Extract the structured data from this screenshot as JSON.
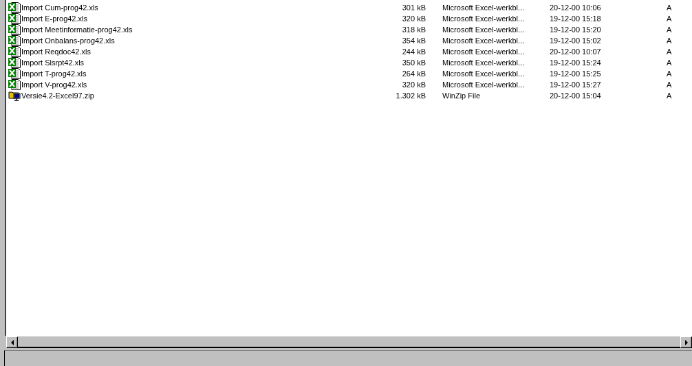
{
  "files": [
    {
      "name": "Import Cum-prog42.xls",
      "kind": "excel",
      "size": "301 kB",
      "type": "Microsoft Excel-werkbl...",
      "modified": "20-12-00 10:06",
      "attributes": "A"
    },
    {
      "name": "Import E-prog42.xls",
      "kind": "excel",
      "size": "320 kB",
      "type": "Microsoft Excel-werkbl...",
      "modified": "19-12-00 15:18",
      "attributes": "A"
    },
    {
      "name": "Import Meetinformatie-prog42.xls",
      "kind": "excel",
      "size": "318 kB",
      "type": "Microsoft Excel-werkbl...",
      "modified": "19-12-00 15:20",
      "attributes": "A"
    },
    {
      "name": "Import Onbalans-prog42.xls",
      "kind": "excel",
      "size": "354 kB",
      "type": "Microsoft Excel-werkbl...",
      "modified": "19-12-00 15:02",
      "attributes": "A"
    },
    {
      "name": "Import Reqdoc42.xls",
      "kind": "excel",
      "size": "244 kB",
      "type": "Microsoft Excel-werkbl...",
      "modified": "20-12-00 10:07",
      "attributes": "A"
    },
    {
      "name": "Import Slsrpt42.xls",
      "kind": "excel",
      "size": "350 kB",
      "type": "Microsoft Excel-werkbl...",
      "modified": "19-12-00 15:24",
      "attributes": "A"
    },
    {
      "name": "Import T-prog42.xls",
      "kind": "excel",
      "size": "264 kB",
      "type": "Microsoft Excel-werkbl...",
      "modified": "19-12-00 15:25",
      "attributes": "A"
    },
    {
      "name": "Import V-prog42.xls",
      "kind": "excel",
      "size": "320 kB",
      "type": "Microsoft Excel-werkbl...",
      "modified": "19-12-00 15:27",
      "attributes": "A"
    },
    {
      "name": "Versie4.2-Excel97.zip",
      "kind": "zip",
      "size": "1.302 kB",
      "type": "WinZip File",
      "modified": "20-12-00 15:04",
      "attributes": "A"
    }
  ]
}
